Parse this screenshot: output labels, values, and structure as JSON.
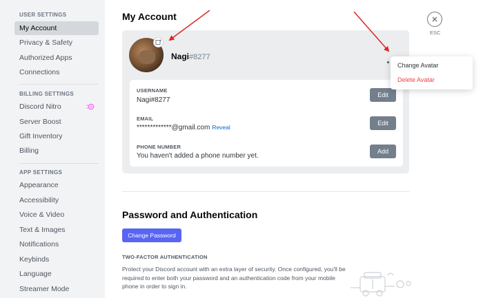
{
  "sidebar": {
    "user_settings_header": "USER SETTINGS",
    "user_items": [
      {
        "label": "My Account",
        "active": true
      },
      {
        "label": "Privacy & Safety"
      },
      {
        "label": "Authorized Apps"
      },
      {
        "label": "Connections"
      }
    ],
    "billing_settings_header": "BILLING SETTINGS",
    "billing_items": [
      {
        "label": "Discord Nitro",
        "icon": "nitro-icon"
      },
      {
        "label": "Server Boost"
      },
      {
        "label": "Gift Inventory"
      },
      {
        "label": "Billing"
      }
    ],
    "app_settings_header": "APP SETTINGS",
    "app_items": [
      {
        "label": "Appearance"
      },
      {
        "label": "Accessibility"
      },
      {
        "label": "Voice & Video"
      },
      {
        "label": "Text & Images"
      },
      {
        "label": "Notifications"
      },
      {
        "label": "Keybinds"
      },
      {
        "label": "Language"
      },
      {
        "label": "Streamer Mode"
      }
    ]
  },
  "header": {
    "title": "My Account",
    "close_label": "ESC"
  },
  "account": {
    "name": "Nagi",
    "discriminator": "#8277",
    "fields": {
      "username_label": "USERNAME",
      "username_value": "Nagi#8277",
      "email_label": "EMAIL",
      "email_value": "*************@gmail.com",
      "reveal_label": "Reveal",
      "phone_label": "PHONE NUMBER",
      "phone_value": "You haven't added a phone number yet."
    },
    "buttons": {
      "edit_username": "Edit",
      "edit_email": "Edit",
      "add_phone": "Add"
    }
  },
  "context_menu": {
    "change_avatar": "Change Avatar",
    "delete_avatar": "Delete Avatar"
  },
  "password_section": {
    "title": "Password and Authentication",
    "change_password": "Change Password",
    "tfa_header": "TWO-FACTOR AUTHENTICATION",
    "tfa_description": "Protect your Discord account with an extra layer of security. Once configured, you'll be required to enter both your password and an authentication code from your mobile phone in order to sign in."
  },
  "colors": {
    "blurple": "#5865f2",
    "danger": "#ed4245",
    "annotation_arrow": "#e02424",
    "nitro": "#ff73fa"
  }
}
